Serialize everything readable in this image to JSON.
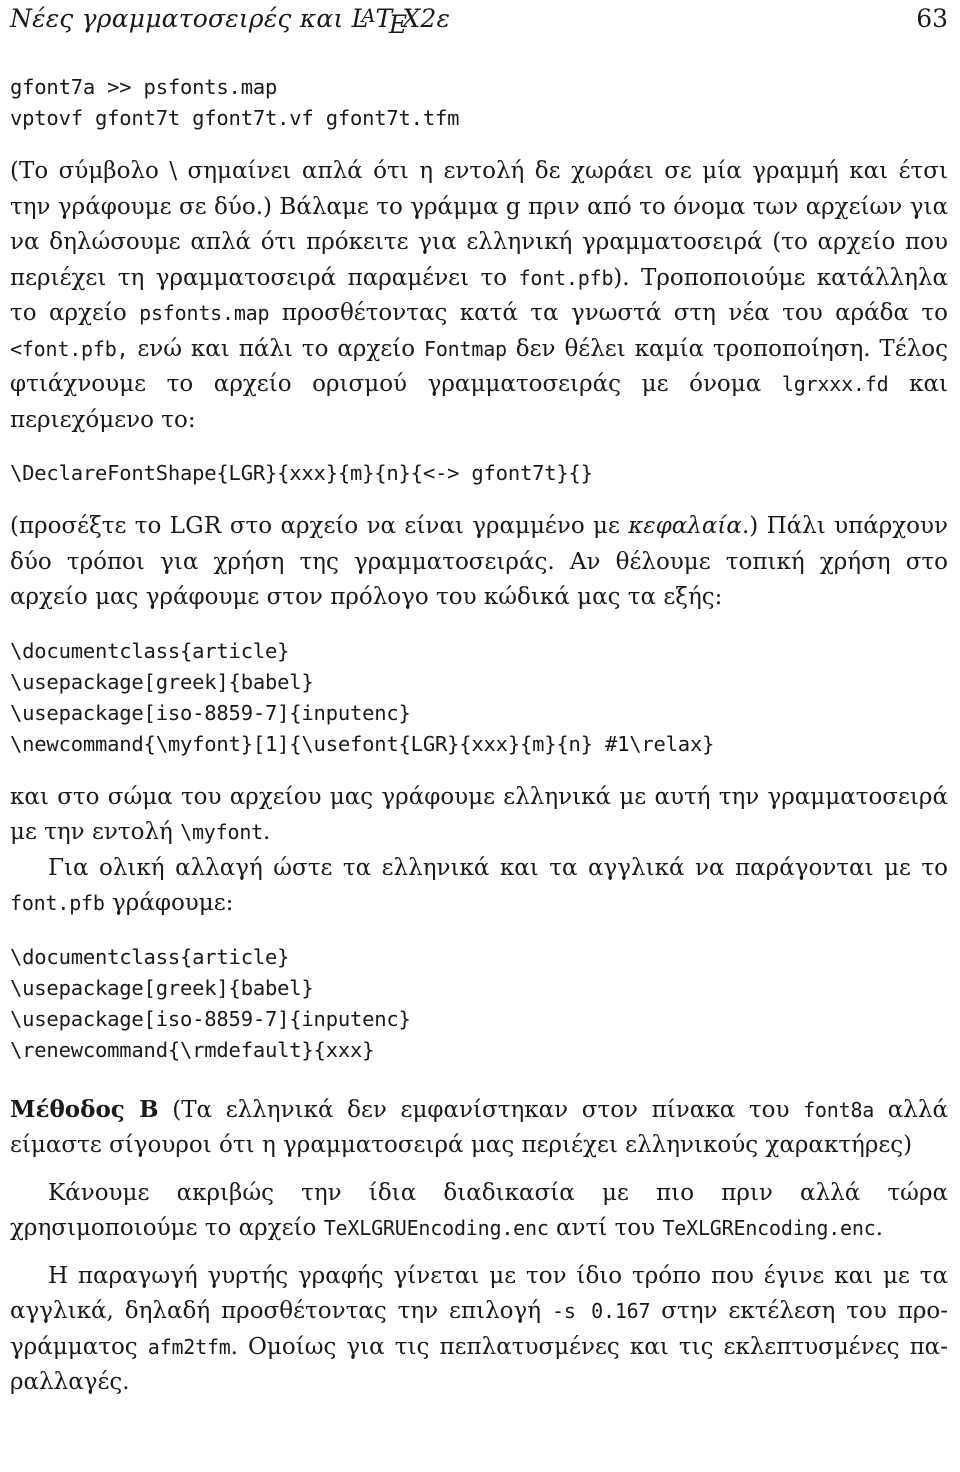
{
  "page": {
    "number": "63",
    "background_color": "#ffffff",
    "text_color": "#1a1a1a"
  },
  "running_head": {
    "title_prefix": "Νέες γραμματοσειρές και ",
    "latex_L": "L",
    "latex_A": "A",
    "latex_T": "T",
    "latex_E": "E",
    "latex_X": "X",
    "latex_version": "2",
    "latex_epsilon": "ε",
    "page_number": "63"
  },
  "blocks": {
    "code1_line1": "gfont7a >> psfonts.map",
    "code1_line2": "vptovf gfont7t gfont7t.vf gfont7t.tfm",
    "para1_a": "(Το σύμβολο \\ σημαίνει απλά ότι η εντολή δε χωράει σε μία γραμμή και έτσι την γράφουμε σε δύο.) Βάλαμε το γράμμα g πριν από το όνομα των αρχείων για να δηλώσουμε απλά ότι πρόκειτε για ελληνική γραμματοσειρά (το αρχείο που περιέχει τη γραμματοσειρά παραμένει το ",
    "para1_tt1": "font.pfb",
    "para1_b": "). Τροποποιούμε κατάλληλα το αρχείο ",
    "para1_tt2": "psfonts.map",
    "para1_c": " προσθέτοντας κατά τα γνωστά στη νέα του αράδα το ",
    "para1_tt3": "<font.pfb,",
    "para1_d": " ενώ και πάλι το αρχείο ",
    "para1_tt4": "Fontmap",
    "para1_e": " δεν θέλει καμία τροποποίηση. Τέλος φτιάχνουμε το αρχείο ορισμού γραμματοσειράς με όνομα ",
    "para1_tt5": "lgrxxx.fd",
    "para1_f": " και περιεχόμενο το:",
    "code2_line1": "\\DeclareFontShape{LGR}{xxx}{m}{n}{<-> gfont7t}{}",
    "para2_a": "(προσέξτε το ",
    "para2_sc": "LGR",
    "para2_b": " στο αρχείο να είναι γραμμένο με ",
    "para2_kef": "κεφαλαία",
    "para2_c": ".) Πάλι υπάρχουν δύο τρόποι για χρήση της γραμματοσειράς. Αν θέλουμε τοπική χρήση στο αρχείο μας γράφουμε στον πρόλογο του κώδικά μας τα εξής:",
    "code3_line1": "\\documentclass{article}",
    "code3_line2": "\\usepackage[greek]{babel}",
    "code3_line3": "\\usepackage[iso-8859-7]{inputenc}",
    "code3_line4": "\\newcommand{\\myfont}[1]{\\usefont{LGR}{xxx}{m}{n} #1\\relax}",
    "para3_a": "και στο σώμα του αρχείου μας γράφουμε ελληνικά με αυτή την γραμματοσειρά με την εντολή ",
    "para3_tt1": "\\myfont",
    "para3_b": ".",
    "para4_a": "Για ολική αλλαγή ώστε τα ελληνικά και τα αγγλικά να παράγονται με το ",
    "para4_tt1": "font.pfb",
    "para4_b": " γράφουμε:",
    "code4_line1": "\\documentclass{article}",
    "code4_line2": "\\usepackage[greek]{babel}",
    "code4_line3": "\\usepackage[iso-8859-7]{inputenc}",
    "code4_line4": "\\renewcommand{\\rmdefault}{xxx}",
    "method_b_title": "Μέθοδος Β",
    "method_b_a": " (Τα ελληνικά δεν εμφανίστηκαν στον πίνακα του ",
    "method_b_tt1": "font8a",
    "method_b_b": " αλλά είμαστε σίγουροι ότι η γραμματοσειρά μας περιέχει ελληνικούς χαρακτήρες)",
    "para5_a": "Κάνουμε ακριβώς την ίδια διαδικασία με πιο πριν αλλά τώρα χρησιμοποιούμε το αρχείο ",
    "para5_tt1": "TeXLGRUEncoding.enc",
    "para5_b": " αντί του ",
    "para5_tt2": "TeXLGREncoding.enc",
    "para5_c": ".",
    "para6_a": "Η παραγωγή γυρτής γραφής γίνεται με τον ίδιο τρόπο που έγινε και με τα αγγλικά, δηλαδή προσθέτοντας την επιλογή ",
    "para6_tt1": "-s 0.167",
    "para6_b": " στην εκτέλεση του προ­γράμματος ",
    "para6_tt2": "afm2tfm",
    "para6_c": ". Ομοίως για τις πεπλατυσμένες και τις εκλεπτυσμένες πα­ραλλαγές."
  }
}
